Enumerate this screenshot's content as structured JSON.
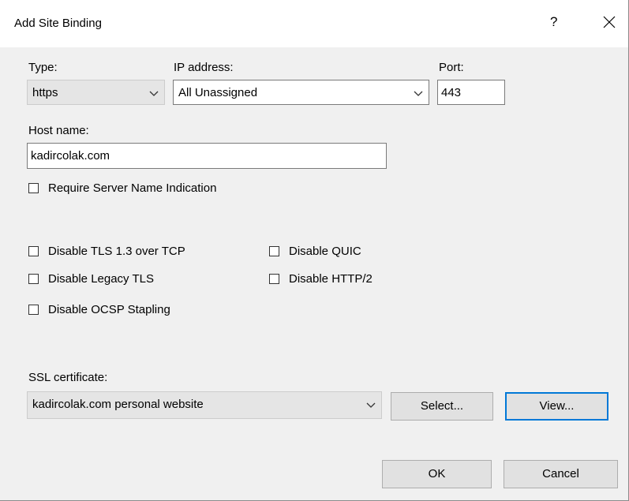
{
  "dialog": {
    "title": "Add Site Binding",
    "help": "?"
  },
  "type": {
    "label": "Type:",
    "value": "https"
  },
  "ip": {
    "label": "IP address:",
    "value": "All Unassigned"
  },
  "port": {
    "label": "Port:",
    "value": "443"
  },
  "host": {
    "label": "Host name:",
    "value": "kadircolak.com"
  },
  "checkboxes": {
    "sni": "Require Server Name Indication",
    "tls13": "Disable TLS 1.3 over TCP",
    "quic": "Disable QUIC",
    "legacy_tls": "Disable Legacy TLS",
    "http2": "Disable HTTP/2",
    "ocsp": "Disable OCSP Stapling"
  },
  "ssl": {
    "label": "SSL certificate:",
    "value": "kadircolak.com personal website",
    "select_label": "Select...",
    "view_label": "View..."
  },
  "footer": {
    "ok_label": "OK",
    "cancel_label": "Cancel"
  }
}
